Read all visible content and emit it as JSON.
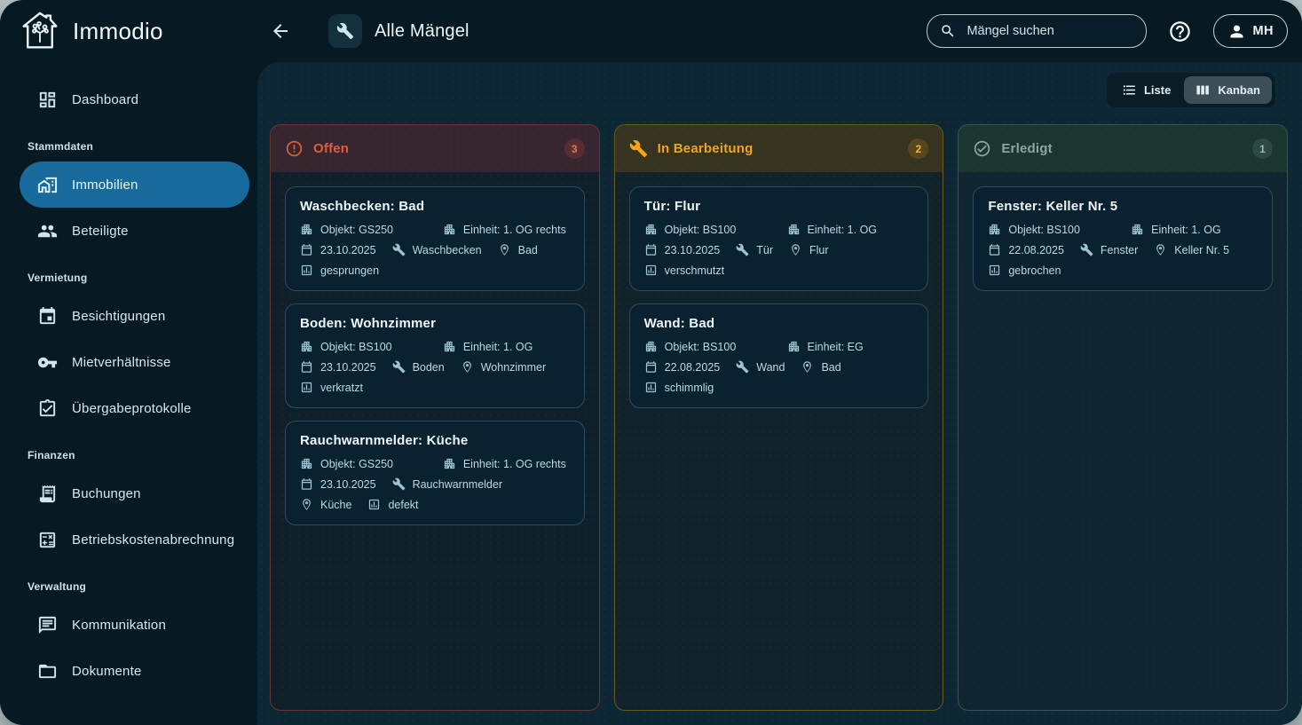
{
  "app": {
    "brand": "Immodio",
    "page_title": "Alle Mängel",
    "search_placeholder": "Mängel suchen",
    "user_initials": "MH"
  },
  "view_toggle": {
    "list_label": "Liste",
    "kanban_label": "Kanban",
    "active": "Kanban"
  },
  "sidebar": {
    "sections": [
      {
        "label": "",
        "items": [
          {
            "label": "Dashboard",
            "icon": "dashboard-icon",
            "active": false
          }
        ]
      },
      {
        "label": "Stammdaten",
        "items": [
          {
            "label": "Immobilien",
            "icon": "home-work-icon",
            "active": true
          },
          {
            "label": "Beteiligte",
            "icon": "group-icon",
            "active": false
          }
        ]
      },
      {
        "label": "Vermietung",
        "items": [
          {
            "label": "Besichtigungen",
            "icon": "calendar-event-icon",
            "active": false
          },
          {
            "label": "Mietverhältnisse",
            "icon": "key-icon",
            "active": false
          },
          {
            "label": "Übergabeprotokolle",
            "icon": "clipboard-check-icon",
            "active": false
          }
        ]
      },
      {
        "label": "Finanzen",
        "items": [
          {
            "label": "Buchungen",
            "icon": "receipt-icon",
            "active": false
          },
          {
            "label": "Betriebskostenabrechnung",
            "icon": "calculator-icon",
            "active": false
          }
        ]
      },
      {
        "label": "Verwaltung",
        "items": [
          {
            "label": "Kommunikation",
            "icon": "chat-icon",
            "active": false
          },
          {
            "label": "Dokumente",
            "icon": "folder-icon",
            "active": false
          }
        ]
      }
    ]
  },
  "kanban": {
    "columns": [
      {
        "title": "Offen",
        "count": "3",
        "accent": "#e25c3c",
        "header_bg": "#372530",
        "icon": "alert-circle-icon",
        "cards": [
          {
            "title": "Waschbecken: Bad",
            "objekt": "Objekt: GS250",
            "einheit": "Einheit: 1. OG rechts",
            "date": "23.10.2025",
            "category": "Waschbecken",
            "location": "Bad",
            "status": "gesprungen"
          },
          {
            "title": "Boden: Wohnzimmer",
            "objekt": "Objekt: BS100",
            "einheit": "Einheit: 1. OG",
            "date": "23.10.2025",
            "category": "Boden",
            "location": "Wohnzimmer",
            "status": "verkratzt"
          },
          {
            "title": "Rauchwarnmelder: Küche",
            "objekt": "Objekt: GS250",
            "einheit": "Einheit: 1. OG rechts",
            "date": "23.10.2025",
            "category": "Rauchwarnmelder",
            "location": "Küche",
            "status": "defekt"
          }
        ]
      },
      {
        "title": "In Bearbeitung",
        "count": "2",
        "accent": "#f0a51a",
        "header_bg": "#363321",
        "icon": "wrench-icon",
        "cards": [
          {
            "title": "Tür: Flur",
            "objekt": "Objekt: BS100",
            "einheit": "Einheit: 1. OG",
            "date": "23.10.2025",
            "category": "Tür",
            "location": "Flur",
            "status": "verschmutzt"
          },
          {
            "title": "Wand: Bad",
            "objekt": "Objekt: BS100",
            "einheit": "Einheit: EG",
            "date": "22.08.2025",
            "category": "Wand",
            "location": "Bad",
            "status": "schimmlig"
          }
        ]
      },
      {
        "title": "Erledigt",
        "count": "1",
        "accent": "#8ba79f",
        "header_bg": "#1b362f",
        "icon": "check-circle-icon",
        "cards": [
          {
            "title": "Fenster: Keller Nr. 5",
            "objekt": "Objekt: BS100",
            "einheit": "Einheit: 1. OG",
            "date": "22.08.2025",
            "category": "Fenster",
            "location": "Keller Nr. 5",
            "status": "gebrochen"
          }
        ]
      }
    ]
  },
  "colors": {
    "window_bg": "#071a24",
    "content_bg": "#0e2734",
    "card_bg": "#0a2130",
    "card_border": "#2c4d5d",
    "active_nav_bg": "#176b9c",
    "page_bg": "#b7c3c7"
  }
}
